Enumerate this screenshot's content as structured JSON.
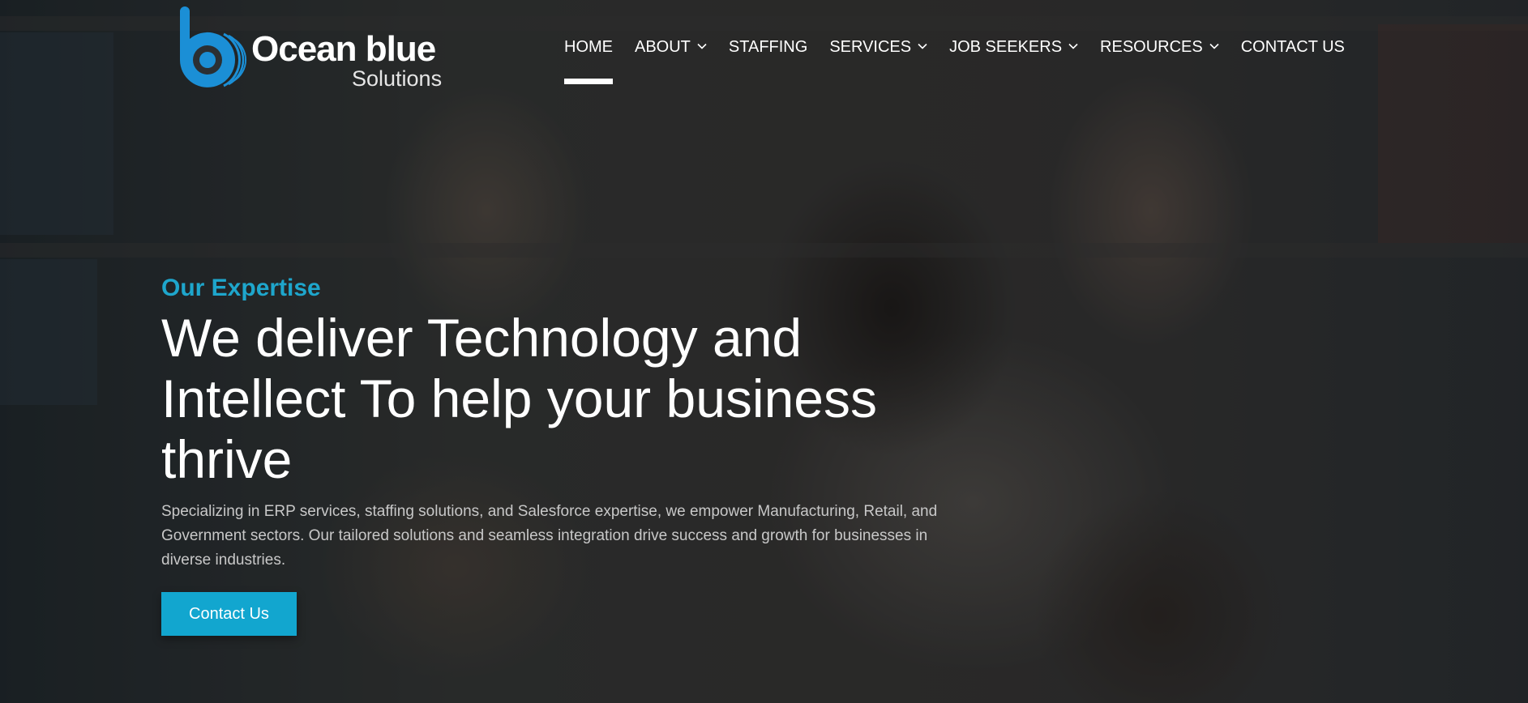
{
  "brand": {
    "name": "Ocean blue",
    "tagline": "Solutions",
    "accent_color": "#1ea6cc",
    "logo_color": "#1b8fd6"
  },
  "nav": {
    "items": [
      {
        "label": "HOME",
        "active": true,
        "has_dropdown": false
      },
      {
        "label": "ABOUT",
        "active": false,
        "has_dropdown": true
      },
      {
        "label": "STAFFING",
        "active": false,
        "has_dropdown": false
      },
      {
        "label": "SERVICES",
        "active": false,
        "has_dropdown": true
      },
      {
        "label": "JOB SEEKERS",
        "active": false,
        "has_dropdown": true
      },
      {
        "label": "RESOURCES",
        "active": false,
        "has_dropdown": true
      },
      {
        "label": "CONTACT US",
        "active": false,
        "has_dropdown": false
      }
    ],
    "dropdown_icon": "chevron-down-icon"
  },
  "hero": {
    "eyebrow": "Our Expertise",
    "headline": "We deliver Technology and Intellect To help your business thrive",
    "description": "Specializing in ERP services, staffing solutions, and Salesforce expertise, we empower Manufacturing, Retail, and Government sectors. Our tailored solutions and seamless integration drive success and growth for businesses in diverse industries.",
    "cta_label": "Contact Us",
    "cta_color": "#12a6cf"
  }
}
